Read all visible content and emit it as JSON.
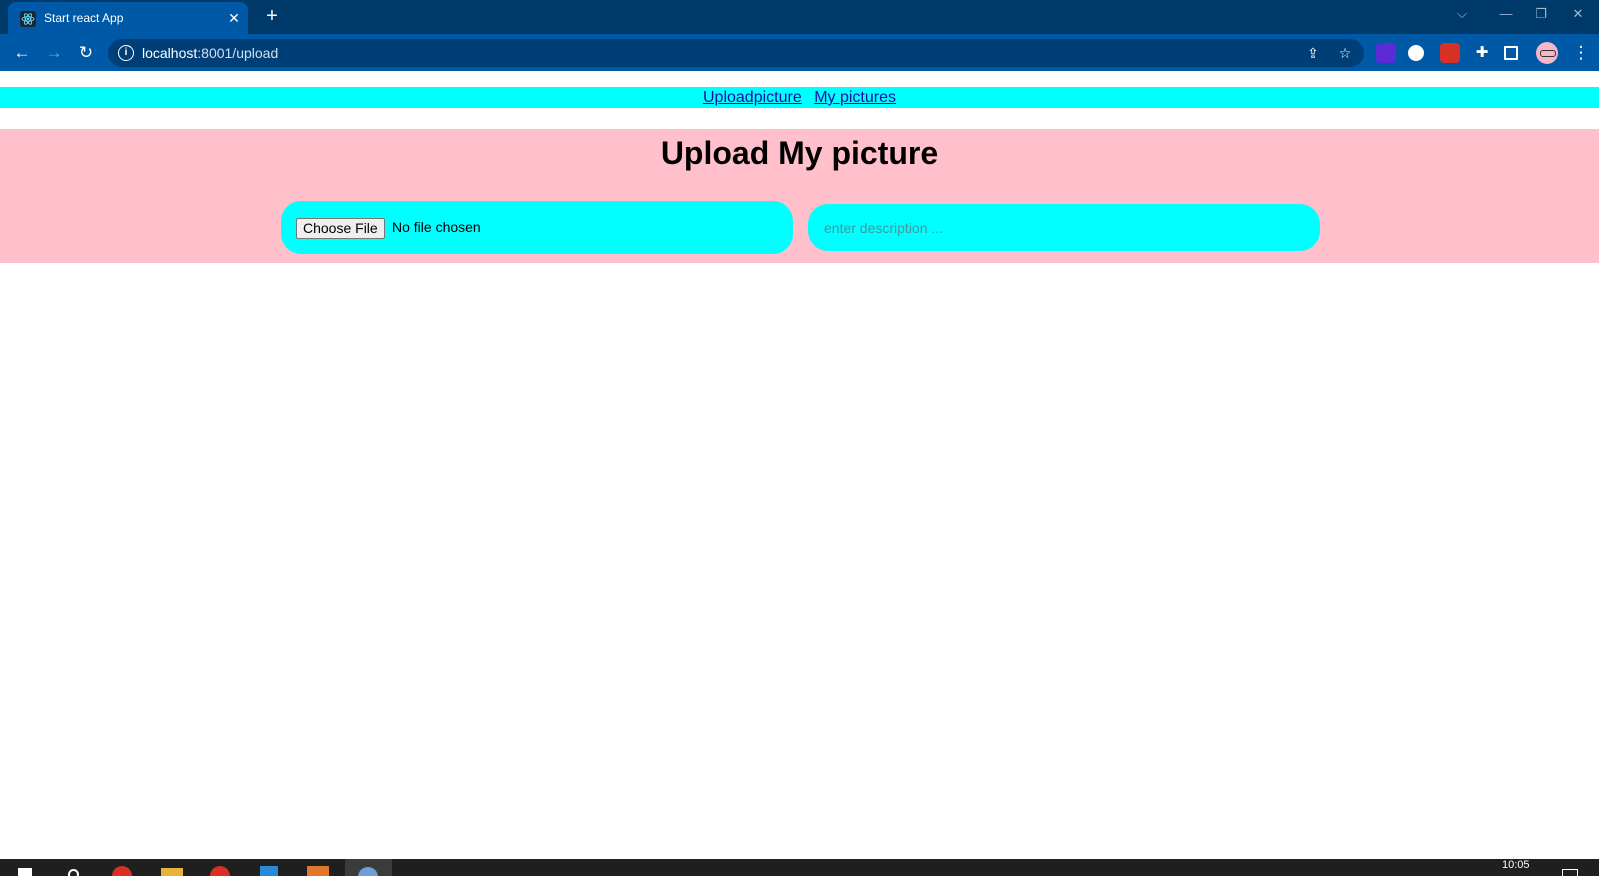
{
  "browser": {
    "tab": {
      "title": "Start react App",
      "close": "✕"
    },
    "new_tab": "+",
    "window_controls": {
      "tabsearch": "⌵",
      "minimize": "—",
      "restore": "❐",
      "close": "✕"
    },
    "nav": {
      "back": "←",
      "forward": "→",
      "reload": "↻"
    },
    "address": {
      "host": "localhost",
      "rest": ":8001/upload"
    },
    "omni_icons": {
      "share": "⇪",
      "bookmark": "☆"
    },
    "menu": "⋮"
  },
  "page": {
    "nav_links": [
      "Uploadpicture",
      "My pictures"
    ],
    "title": "Upload My picture",
    "file": {
      "button": "Choose File",
      "status": "No file chosen"
    },
    "description": {
      "placeholder": "enter description ..."
    }
  },
  "taskbar": {
    "time": "10:05"
  },
  "colors": {
    "nav_bg": "#00ffff",
    "section_bg": "#ffc0cb",
    "chrome_tabbar": "#003a6a",
    "chrome_toolbar": "#0059a6"
  }
}
